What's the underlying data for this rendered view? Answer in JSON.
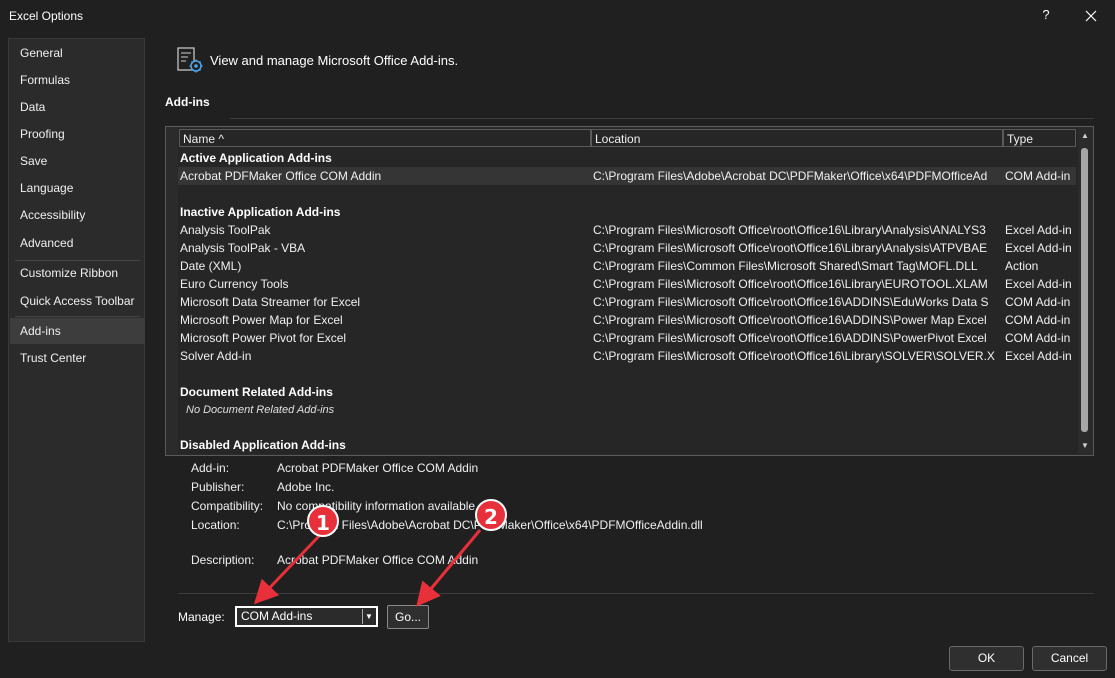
{
  "window": {
    "title": "Excel Options",
    "help_label": "?",
    "close_label": "✕"
  },
  "sidebar": {
    "items": [
      {
        "label": "General"
      },
      {
        "label": "Formulas"
      },
      {
        "label": "Data"
      },
      {
        "label": "Proofing"
      },
      {
        "label": "Save"
      },
      {
        "label": "Language"
      },
      {
        "label": "Accessibility"
      },
      {
        "label": "Advanced"
      },
      {
        "label": "Customize Ribbon"
      },
      {
        "label": "Quick Access Toolbar"
      },
      {
        "label": "Add-ins"
      },
      {
        "label": "Trust Center"
      }
    ],
    "active": "Add-ins"
  },
  "header": {
    "text": "View and manage Microsoft Office Add-ins.",
    "icon": "addins-gear-icon"
  },
  "section": {
    "title": "Add-ins"
  },
  "table": {
    "columns": [
      "Name ^",
      "Location",
      "Type"
    ],
    "groups": {
      "active": "Active Application Add-ins",
      "inactive": "Inactive Application Add-ins",
      "document": "Document Related Add-ins",
      "document_note": "No Document Related Add-ins",
      "disabled": "Disabled Application Add-ins"
    },
    "active_rows": [
      {
        "name": "Acrobat PDFMaker Office COM Addin",
        "location": "C:\\Program Files\\Adobe\\Acrobat DC\\PDFMaker\\Office\\x64\\PDFMOfficeAd",
        "type": "COM Add-in"
      }
    ],
    "inactive_rows": [
      {
        "name": "Analysis ToolPak",
        "location": "C:\\Program Files\\Microsoft Office\\root\\Office16\\Library\\Analysis\\ANALYS3",
        "type": "Excel Add-in"
      },
      {
        "name": "Analysis ToolPak - VBA",
        "location": "C:\\Program Files\\Microsoft Office\\root\\Office16\\Library\\Analysis\\ATPVBAE",
        "type": "Excel Add-in"
      },
      {
        "name": "Date (XML)",
        "location": "C:\\Program Files\\Common Files\\Microsoft Shared\\Smart Tag\\MOFL.DLL",
        "type": "Action"
      },
      {
        "name": "Euro Currency Tools",
        "location": "C:\\Program Files\\Microsoft Office\\root\\Office16\\Library\\EUROTOOL.XLAM",
        "type": "Excel Add-in"
      },
      {
        "name": "Microsoft Data Streamer for Excel",
        "location": "C:\\Program Files\\Microsoft Office\\root\\Office16\\ADDINS\\EduWorks Data S",
        "type": "COM Add-in"
      },
      {
        "name": "Microsoft Power Map for Excel",
        "location": "C:\\Program Files\\Microsoft Office\\root\\Office16\\ADDINS\\Power Map Excel",
        "type": "COM Add-in"
      },
      {
        "name": "Microsoft Power Pivot for Excel",
        "location": "C:\\Program Files\\Microsoft Office\\root\\Office16\\ADDINS\\PowerPivot Excel",
        "type": "COM Add-in"
      },
      {
        "name": "Solver Add-in",
        "location": "C:\\Program Files\\Microsoft Office\\root\\Office16\\Library\\SOLVER\\SOLVER.X",
        "type": "Excel Add-in"
      }
    ]
  },
  "details": {
    "addin_label": "Add-in:",
    "addin_value": "Acrobat PDFMaker Office COM Addin",
    "publisher_label": "Publisher:",
    "publisher_value": "Adobe Inc.",
    "compat_label": "Compatibility:",
    "compat_value": "No compatibility information available",
    "location_label": "Location:",
    "location_value": "C:\\Program Files\\Adobe\\Acrobat DC\\PDFMaker\\Office\\x64\\PDFMOfficeAddin.dll",
    "description_label": "Description:",
    "description_value": "Acrobat PDFMaker Office COM Addin"
  },
  "manage": {
    "label": "Manage:",
    "selected": "COM Add-ins",
    "go_label": "Go..."
  },
  "footer": {
    "ok_label": "OK",
    "cancel_label": "Cancel"
  },
  "annotations": {
    "badge1": "1",
    "badge2": "2",
    "color": "#e8303a"
  }
}
